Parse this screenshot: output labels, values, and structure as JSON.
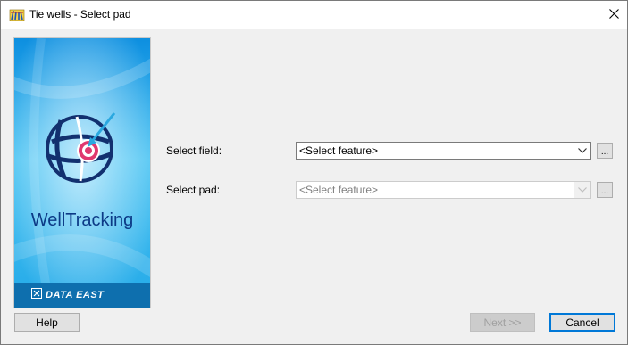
{
  "window": {
    "title": "Tie wells - Select pad",
    "app_icon": "well-app-icon",
    "close_icon": "close-icon"
  },
  "banner": {
    "brand_name": "WellTracking",
    "company": "DATA EAST",
    "logo_icon": "globe-target-logo"
  },
  "form": {
    "field": {
      "label": "Select field:",
      "value": "<Select feature>",
      "browse_label": "..."
    },
    "pad": {
      "label": "Select pad:",
      "value": "<Select feature>",
      "browse_label": "..."
    }
  },
  "buttons": {
    "help": "Help",
    "next": "Next >>",
    "cancel": "Cancel"
  },
  "colors": {
    "accent": "#0078d7",
    "banner_blue": "#1aa6e8",
    "brand_text": "#0c3a86"
  }
}
